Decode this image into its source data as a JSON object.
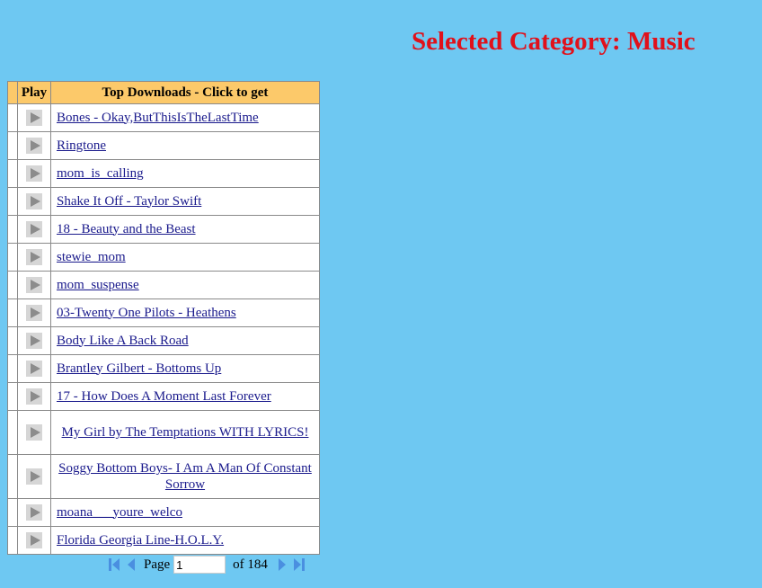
{
  "header": {
    "category_title": "Selected Category: Music",
    "title_color": "#e0111b"
  },
  "table": {
    "headers": {
      "play": "Play",
      "title": "Top Downloads - Click to get"
    },
    "header_color": "#fcc96a",
    "rows": [
      {
        "title": "Bones - Okay,ButThisIsTheLastTime"
      },
      {
        "title": "Ringtone"
      },
      {
        "title": "mom_is_calling"
      },
      {
        "title": "Shake It Off - Taylor Swift"
      },
      {
        "title": "18 - Beauty and the Beast"
      },
      {
        "title": "stewie_mom"
      },
      {
        "title": "mom_suspense"
      },
      {
        "title": "03-Twenty One Pilots - Heathens"
      },
      {
        "title": "Body Like A Back Road"
      },
      {
        "title": "Brantley Gilbert - Bottoms Up"
      },
      {
        "title": "17 - How Does A Moment Last Forever"
      },
      {
        "title": "My Girl by The Temptations WITH LYRICS!"
      },
      {
        "title": "Soggy Bottom Boys- I Am A Man Of Constant Sorrow"
      },
      {
        "title": "moana___youre_welco"
      },
      {
        "title": "Florida Georgia Line-H.O.L.Y."
      }
    ]
  },
  "pager": {
    "page_label": "Page",
    "current_page": "1",
    "of_label": "of 184",
    "icons": [
      "first-page-icon",
      "prev-page-icon",
      "next-page-icon",
      "last-page-icon"
    ]
  }
}
